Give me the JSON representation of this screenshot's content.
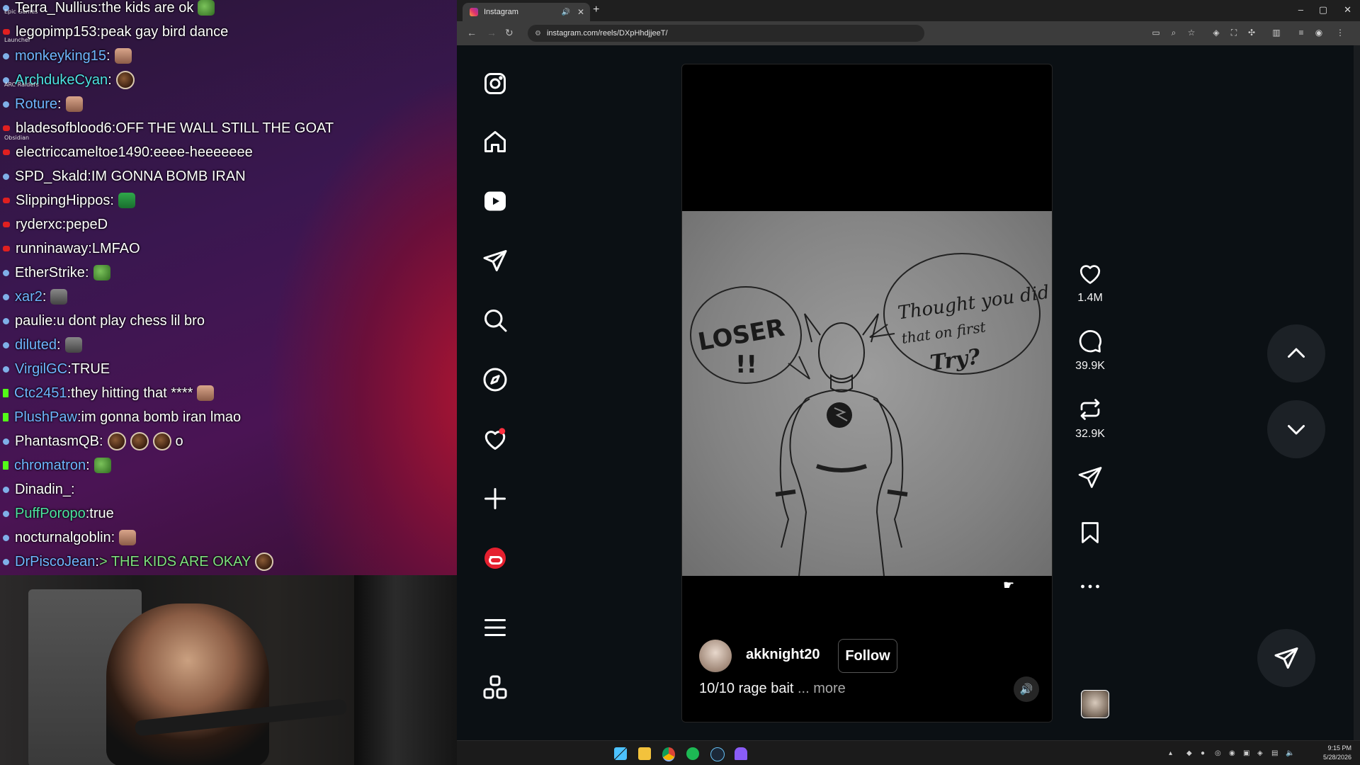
{
  "desktop": {
    "icons": [
      "Epic Games",
      "Launcher",
      "ARC Raiders",
      "Obsidian"
    ]
  },
  "chat": {
    "messages": [
      {
        "badge": "tw",
        "user": "Terra_Nullius",
        "user_color": "#ffffff",
        "text": "the kids are ok",
        "emote": "pepe"
      },
      {
        "badge": "yt",
        "user": "legopimp153",
        "user_color": "#ffffff",
        "text": "peak gay bird dance",
        "emote": ""
      },
      {
        "badge": "tw",
        "user": "monkeyking15",
        "user_color": "#6fb6ff",
        "text": "",
        "emote": "face"
      },
      {
        "badge": "tw",
        "user": "ArchdukeCyan",
        "user_color": "#4de3e3",
        "text": "",
        "emote": "round"
      },
      {
        "badge": "tw",
        "user": "Roture",
        "user_color": "#6fb6ff",
        "text": "",
        "emote": "face"
      },
      {
        "badge": "yt",
        "user": "bladesofblood6",
        "user_color": "#ffffff",
        "text": "OFF THE WALL STILL THE GOAT",
        "emote": ""
      },
      {
        "badge": "yt",
        "user": "electriccameltoe1490",
        "user_color": "#ffffff",
        "text": "eeee-heeeeeee",
        "emote": ""
      },
      {
        "badge": "tw",
        "user": "SPD_Skald",
        "user_color": "#ffffff",
        "text": "IM GONNA BOMB IRAN",
        "emote": ""
      },
      {
        "badge": "yt",
        "user": "SlippingHippos",
        "user_color": "#ffffff",
        "text": "",
        "emote": "grin"
      },
      {
        "badge": "yt",
        "user": "ryderxc",
        "user_color": "#ffffff",
        "text": "pepeD",
        "emote": ""
      },
      {
        "badge": "yt",
        "user": "runninaway",
        "user_color": "#ffffff",
        "text": "LMFAO",
        "emote": ""
      },
      {
        "badge": "tw",
        "user": "EtherStrike",
        "user_color": "#ffffff",
        "text": "",
        "emote": "pepe"
      },
      {
        "badge": "tw",
        "user": "xar2",
        "user_color": "#6fb6ff",
        "text": "",
        "emote": "grey"
      },
      {
        "badge": "tw",
        "user": "paulie",
        "user_color": "#ffffff",
        "text": "u dont play chess lil bro",
        "emote": ""
      },
      {
        "badge": "tw",
        "user": "diluted",
        "user_color": "#6fb6ff",
        "text": "",
        "emote": "grey"
      },
      {
        "badge": "tw",
        "user": "VirgilGC",
        "user_color": "#6fb6ff",
        "text": "TRUE",
        "emote": ""
      },
      {
        "badge": "k",
        "user": "Ctc2451",
        "user_color": "#6fb6ff",
        "text": "they hitting that ****",
        "emote": "face"
      },
      {
        "badge": "k",
        "user": "PlushPaw",
        "user_color": "#6fb6ff",
        "text": "im gonna bomb iran lmao",
        "emote": ""
      },
      {
        "badge": "tw",
        "user": "PhantasmQB",
        "user_color": "#ffffff",
        "text": "",
        "emote": "round3",
        "suffix": "o"
      },
      {
        "badge": "k",
        "user": "chromatron",
        "user_color": "#6fb6ff",
        "text": "",
        "emote": "pepe"
      },
      {
        "badge": "tw",
        "user": "Dinadin_",
        "user_color": "#ffffff",
        "text": "",
        "emote": ""
      },
      {
        "badge": "tw",
        "user": "PuffPoropo",
        "user_color": "#4de3a0",
        "text": "true",
        "emote": ""
      },
      {
        "badge": "tw",
        "user": "nocturnalgoblin",
        "user_color": "#ffffff",
        "text": "",
        "emote": "face"
      },
      {
        "badge": "tw",
        "user": "DrPiscoJean",
        "user_color": "#6fb6ff",
        "text": "> THE KIDS ARE OKAY",
        "text_color": "#7ee07e",
        "emote": "round"
      }
    ]
  },
  "browser": {
    "tab_title": "Instagram",
    "new_tab": "+",
    "url": "instagram.com/reels/DXpHhdjjeeT/",
    "window_controls": [
      "–",
      "▢",
      "✕"
    ]
  },
  "reel": {
    "drawing_text": [
      "LOSER",
      "!!",
      "Thought you did",
      "that on first",
      "Try?"
    ],
    "username": "akknight20",
    "follow_label": "Follow",
    "caption": "10/10 rage bait",
    "caption_more": "... more",
    "likes": "1.4M",
    "comments": "39.9K",
    "reposts": "32.9K"
  },
  "taskbar": {
    "time": "9:15 PM",
    "date": "5/28/2026"
  },
  "colors": {
    "instagram_bg": "#0b1014",
    "notification_dot": "#ff3040",
    "threads_red": "#e5202f"
  }
}
